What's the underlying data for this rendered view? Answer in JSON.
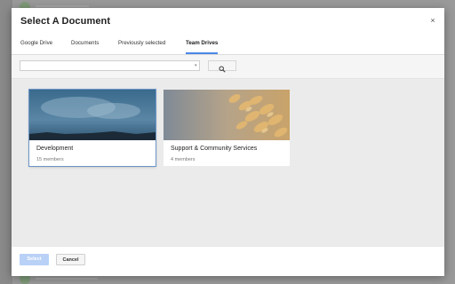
{
  "dialog": {
    "title": "Select A Document",
    "close_glyph": "×"
  },
  "tabs": [
    {
      "label": "Google Drive",
      "active": false
    },
    {
      "label": "Documents",
      "active": false
    },
    {
      "label": "Previously selected",
      "active": false
    },
    {
      "label": "Team Drives",
      "active": true
    }
  ],
  "search": {
    "value": "",
    "dropdown_icon": "caret-down-icon",
    "button_icon": "search-icon"
  },
  "drives": [
    {
      "name": "Development",
      "members": "15 members",
      "selected": true,
      "thumbnail": "ocean-sky-thumbnail"
    },
    {
      "name": "Support & Community Services",
      "members": "4 members",
      "selected": false,
      "thumbnail": "wheat-thumbnail"
    }
  ],
  "footer": {
    "select_label": "Select",
    "cancel_label": "Cancel"
  },
  "colors": {
    "accent": "#4a86e8",
    "select_button_disabled": "#b9d1f7",
    "content_background": "#ebebeb"
  }
}
